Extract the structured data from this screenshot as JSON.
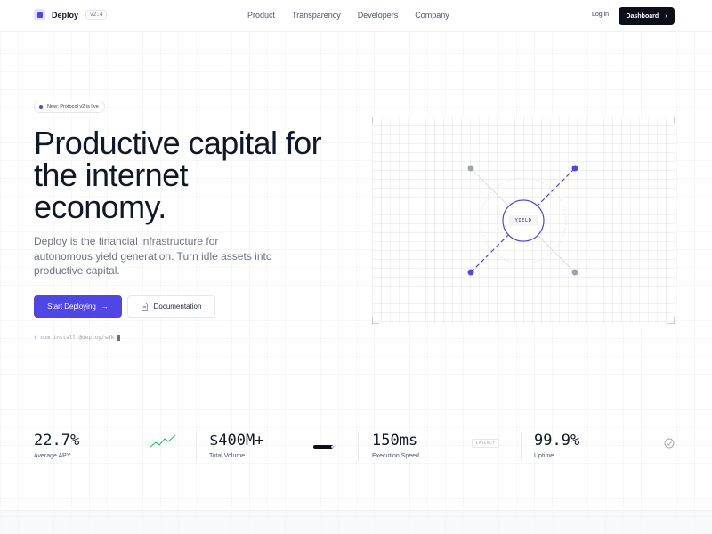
{
  "nav": {
    "brand": "Deploy",
    "version": "v2.4",
    "links": [
      "Product",
      "Transparency",
      "Developers",
      "Company"
    ],
    "login": "Log in",
    "dashboard": "Dashboard",
    "logo_icon": "square-logo-icon",
    "dashboard_icon": "chevron-right-icon"
  },
  "hero": {
    "badge": "New: Protocol v2 is live",
    "title_lines": [
      "Productive capital for",
      "the internet",
      "economy."
    ],
    "subtitle": "Deploy is the financial infrastructure for autonomous yield generation. Turn idle assets into productive capital.",
    "primary_cta": "Start Deploying",
    "primary_cta_icon": "arrow-right-icon",
    "secondary_cta": "Documentation",
    "secondary_cta_icon": "document-icon",
    "install_command": "$ npm install @deploy/sdk"
  },
  "visual": {
    "center_label": "YIELD"
  },
  "stats": [
    {
      "value": "22.7%",
      "label": "Average APY",
      "icon": "trend-line-icon"
    },
    {
      "value": "$400M+",
      "label": "Total Volume",
      "icon": "bar-indicator-icon"
    },
    {
      "value": "150ms",
      "label": "Execution Speed",
      "badge": "LATENCY"
    },
    {
      "value": "99.9%",
      "label": "Uptime",
      "icon": "check-circle-icon"
    }
  ],
  "colors": {
    "accent": "#4f46e5",
    "dark": "#0b0f19",
    "positive": "#22c55e",
    "muted": "#9ca3af"
  }
}
